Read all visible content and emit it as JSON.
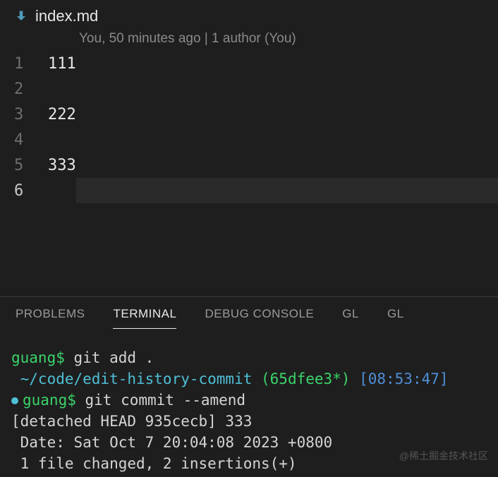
{
  "tab": {
    "filename": "index.md"
  },
  "codelens": {
    "text": "You, 50 minutes ago | 1 author (You)"
  },
  "editor": {
    "lines": [
      {
        "num": "1",
        "text": "111",
        "active": false
      },
      {
        "num": "2",
        "text": "",
        "active": false
      },
      {
        "num": "3",
        "text": "222",
        "active": false
      },
      {
        "num": "4",
        "text": "",
        "active": false
      },
      {
        "num": "5",
        "text": "333",
        "active": false
      },
      {
        "num": "6",
        "text": "",
        "active": true
      }
    ]
  },
  "panel": {
    "tabs": {
      "problems": "PROBLEMS",
      "terminal": "TERMINAL",
      "debug": "DEBUG CONSOLE",
      "gl1": "GL",
      "gl2": "GL"
    }
  },
  "terminal": {
    "l1_prompt": "guang$",
    "l1_cmd": " git add .",
    "l2_path": " ~/code/edit-history-commit",
    "l2_branch": " (65dfee3*)",
    "l2_time": " [08:53:47]",
    "l3_prompt": "guang$",
    "l3_cmd": " git commit --amend",
    "l4": "[detached HEAD 935cecb] 333",
    "l5": " Date: Sat Oct 7 20:04:08 2023 +0800",
    "l6": " 1 file changed, 2 insertions(+)"
  },
  "watermark": "@稀土掘金技术社区"
}
